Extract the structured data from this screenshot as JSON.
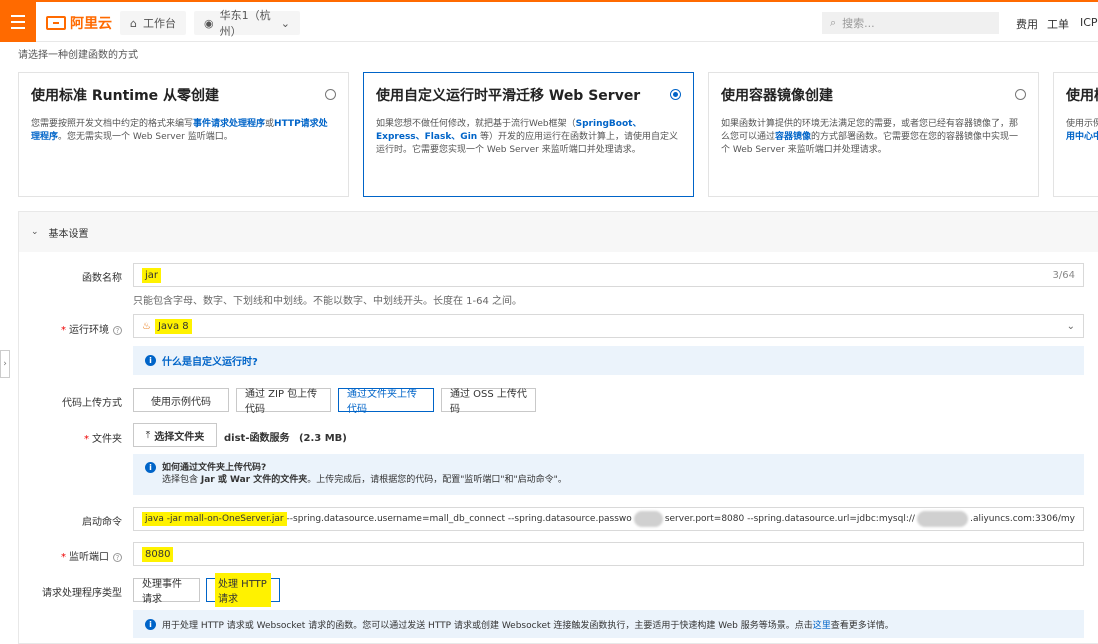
{
  "topbar": {
    "logo": "阿里云",
    "workbench": "工作台",
    "region": "华东1（杭州）",
    "search_placeholder": "搜索...",
    "links": [
      "费用",
      "工单",
      "ICP"
    ]
  },
  "page": {
    "subtitle": "请选择一种创建函数的方式"
  },
  "cards": [
    {
      "title": "使用标准 Runtime 从零创建",
      "desc_pre": "您需要按照开发文档中约定的格式来编写",
      "desc_link1": "事件请求处理程序",
      "desc_mid": "或",
      "desc_link2": "HTTP请求处理程序",
      "desc_post": "。您无需实现一个 Web Server 监听端口。"
    },
    {
      "title": "使用自定义运行时平滑迁移 Web Server",
      "desc_pre": "如果您想不做任何修改，就把基于流行Web框架（",
      "desc_link1": "SpringBoot、Express、Flask、Gin",
      "desc_post": " 等）开发的应用运行在函数计算上，请使用自定义运行时。它需要您实现一个 Web Server 来监听端口并处理请求。"
    },
    {
      "title": "使用容器镜像创建",
      "desc_pre": "如果函数计算提供的环境无法满足您的需要，或者您已经有容器镜像了，那么您可以通过",
      "desc_link1": "容器镜像",
      "desc_post": "的方式部署函数。它需要您在您的容器镜像中实现一个 Web Server 来监听端口并处理请求。"
    },
    {
      "title": "使用模",
      "desc_pre": "使用示例",
      "desc_link1": "用中心中"
    }
  ],
  "section": {
    "title": "基本设置"
  },
  "form": {
    "name_label": "函数名称",
    "name_value": "jar",
    "name_count": "3/64",
    "name_hint": "只能包含字母、数字、下划线和中划线。不能以数字、中划线开头。长度在 1-64 之间。",
    "runtime_label": "运行环境",
    "runtime_value": "Java 8",
    "runtime_help": "什么是自定义运行时?",
    "upload_label": "代码上传方式",
    "upload_options": [
      "使用示例代码",
      "通过 ZIP 包上传代码",
      "通过文件夹上传代码",
      "通过 OSS 上传代码"
    ],
    "folder_label": "文件夹",
    "folder_button": "选择文件夹",
    "folder_name": "dist-函数服务",
    "folder_size": "(2.3 MB)",
    "folder_help_title": "如何通过文件夹上传代码?",
    "folder_help_body_pre": "选择包含 ",
    "folder_help_body_bold": "Jar 或 War 文件的文件夹",
    "folder_help_body_post": "。上传完成后，请根据您的代码，配置\"监听端口\"和\"启动命令\"。",
    "cmd_label": "启动命令",
    "cmd_highlight": "java -jar mall-on-OneServer.jar",
    "cmd_part1": " --spring.datasource.username=mall_db_connect --spring.datasource.passwo",
    "cmd_part2": "server.port=8080 --spring.datasource.url=jdbc:mysql://",
    "cmd_part3": ".aliyuncs.com:3306/my",
    "port_label": "监听端口",
    "port_value": "8080",
    "handler_label": "请求处理程序类型",
    "handler_options": [
      "处理事件请求",
      "处理 HTTP 请求"
    ],
    "handler_info_pre": "用于处理 HTTP 请求或 Websocket 请求的函数。您可以通过发送 HTTP 请求或创建 Websocket 连接触发函数执行，主要适用于快速构建 Web 服务等场景。点击",
    "handler_info_link": "这里",
    "handler_info_post": "查看更多详情。"
  },
  "colors": {
    "brand": "#ff6a00",
    "primary": "#0064c8",
    "highlight": "#fff200"
  }
}
